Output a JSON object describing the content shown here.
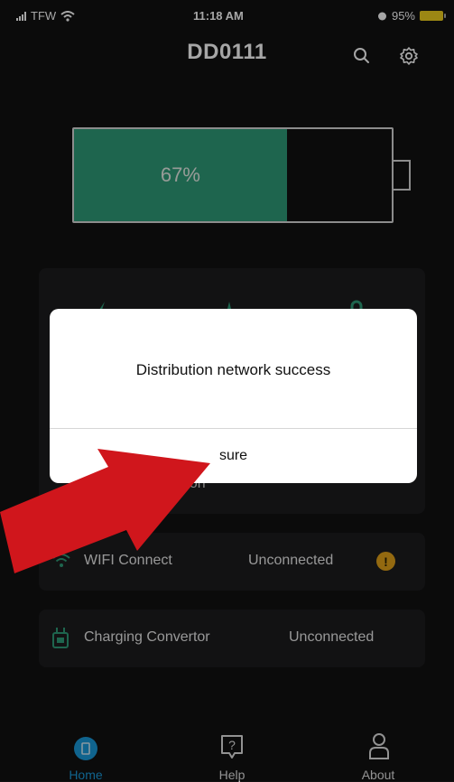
{
  "status_bar": {
    "carrier": "TFW",
    "time": "11:18 AM",
    "battery": "95%"
  },
  "header": {
    "title": "DD0111",
    "icons": [
      "search-icon",
      "gear-icon"
    ]
  },
  "battery": {
    "percent_text": "67%",
    "level": 0.67,
    "fill_color": "#2f9b78"
  },
  "stats_card": {
    "partial_label": "ation",
    "icons": [
      "bolt-icon",
      "voltage-icon",
      "temperature-icon"
    ]
  },
  "wifi_row": {
    "label": "WIFI Connect",
    "status": "Unconnected",
    "warning": "!",
    "icon": "wifi-icon"
  },
  "charging_row": {
    "label": "Charging Convertor",
    "status": "Unconnected",
    "icon": "charger-icon"
  },
  "nav": {
    "items": [
      {
        "label": "Home",
        "icon": "home-icon",
        "active": true
      },
      {
        "label": "Help",
        "icon": "help-icon",
        "active": false
      },
      {
        "label": "About",
        "icon": "user-icon",
        "active": false
      }
    ],
    "active_color": "#1a9adb"
  },
  "dialog": {
    "message": "Distribution network success",
    "button": "sure"
  },
  "colors": {
    "background": "#111112",
    "card": "#1c1c1e",
    "accent_green": "#2f9b78",
    "warning": "#e2a21a",
    "arrow": "#d0161c"
  }
}
